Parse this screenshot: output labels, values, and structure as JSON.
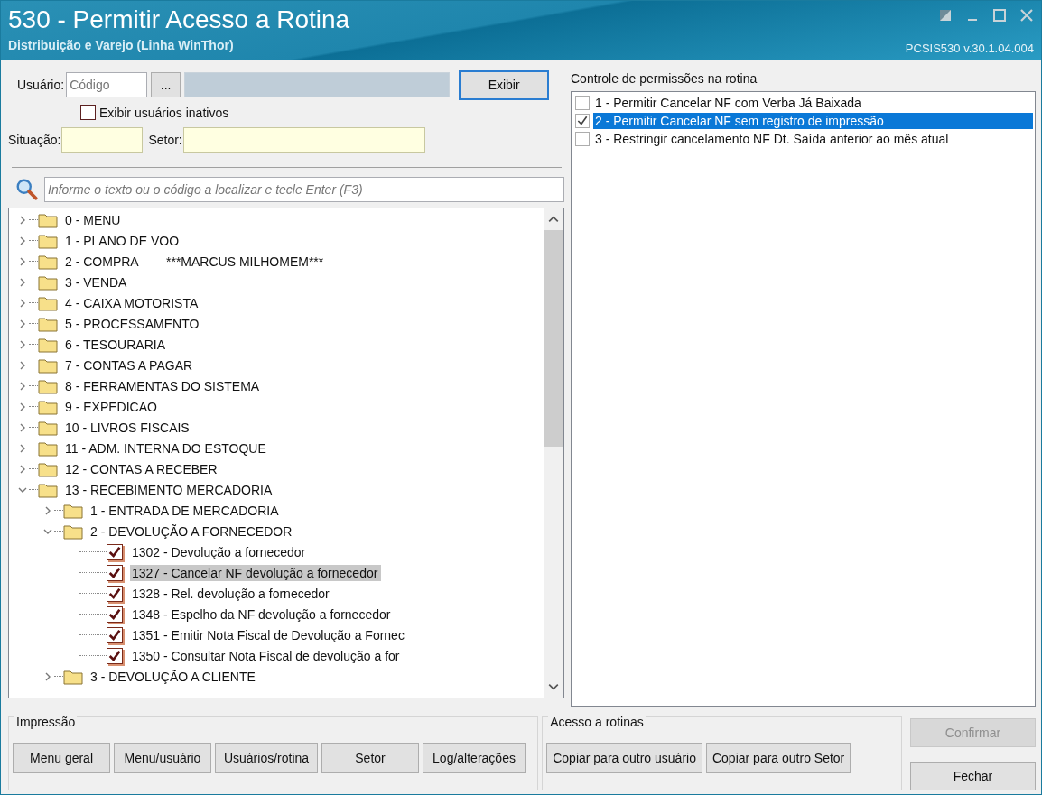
{
  "window": {
    "title": "530 - Permitir Acesso a Rotina",
    "subtitle": "Distribuição e Varejo (Linha WinThor)",
    "version": "PCSIS530  v.30.1.04.004"
  },
  "user": {
    "label": "Usuário:",
    "code_placeholder": "Código",
    "lookup_button": "...",
    "show_button": "Exibir",
    "inactive_label": "Exibir usuários inativos",
    "inactive_checked": false
  },
  "filters": [
    {
      "label": "Situação:"
    },
    {
      "label": "Setor:"
    }
  ],
  "search": {
    "placeholder": "Informe o texto ou o código a localizar e tecle Enter (F3)"
  },
  "tree": [
    {
      "kind": "folder",
      "label": "0 - MENU",
      "expanded": false,
      "selected": false
    },
    {
      "kind": "folder",
      "label": "1 - PLANO DE VOO",
      "expanded": false,
      "selected": false
    },
    {
      "kind": "folder",
      "label": "2 - COMPRA        ***MARCUS MILHOMEM***",
      "expanded": false,
      "selected": false
    },
    {
      "kind": "folder",
      "label": "3 - VENDA",
      "expanded": false,
      "selected": false
    },
    {
      "kind": "folder",
      "label": "4 - CAIXA MOTORISTA",
      "expanded": false,
      "selected": false
    },
    {
      "kind": "folder",
      "label": "5 - PROCESSAMENTO",
      "expanded": false,
      "selected": false
    },
    {
      "kind": "folder",
      "label": "6 - TESOURARIA",
      "expanded": false,
      "selected": false
    },
    {
      "kind": "folder",
      "label": "7 - CONTAS A PAGAR",
      "expanded": false,
      "selected": false
    },
    {
      "kind": "folder",
      "label": "8 - FERRAMENTAS DO SISTEMA",
      "expanded": false,
      "selected": false
    },
    {
      "kind": "folder",
      "label": "9 - EXPEDICAO",
      "expanded": false,
      "selected": false
    },
    {
      "kind": "folder",
      "label": "10 - LIVROS FISCAIS",
      "expanded": false,
      "selected": false
    },
    {
      "kind": "folder",
      "label": "11 - ADM. INTERNA DO ESTOQUE",
      "expanded": false,
      "selected": false
    },
    {
      "kind": "folder",
      "label": "12 - CONTAS A RECEBER",
      "expanded": false,
      "selected": false
    },
    {
      "kind": "folder",
      "label": "13 - RECEBIMENTO MERCADORIA",
      "expanded": true,
      "selected": false,
      "children": [
        {
          "kind": "folder",
          "label": "1 - ENTRADA DE MERCADORIA",
          "expanded": false,
          "selected": false
        },
        {
          "kind": "folder",
          "label": "2 - DEVOLUÇÃO A FORNECEDOR",
          "expanded": true,
          "selected": false,
          "children": [
            {
              "kind": "routine",
              "label": "1302 - Devolução a fornecedor",
              "checked": true,
              "selected": false
            },
            {
              "kind": "routine",
              "label": "1327 - Cancelar NF devolução a fornecedor",
              "checked": true,
              "selected": true
            },
            {
              "kind": "routine",
              "label": "1328 - Rel. devolução a fornecedor",
              "checked": true,
              "selected": false
            },
            {
              "kind": "routine",
              "label": "1348 - Espelho da NF devolução a fornecedor",
              "checked": true,
              "selected": false
            },
            {
              "kind": "routine",
              "label": "1351 - Emitir Nota Fiscal de Devolução a Fornec",
              "checked": true,
              "selected": false
            },
            {
              "kind": "routine",
              "label": "1350 - Consultar Nota Fiscal de devolução a for",
              "checked": true,
              "selected": false
            }
          ]
        },
        {
          "kind": "folder",
          "label": "3 - DEVOLUÇÃO A CLIENTE",
          "expanded": false,
          "selected": false
        }
      ]
    }
  ],
  "permissions": {
    "title": "Controle de permissões na rotina",
    "items": [
      {
        "label": "1 - Permitir Cancelar NF com Verba Já Baixada",
        "checked": false,
        "selected": false
      },
      {
        "label": "2 - Permitir Cancelar NF sem registro de impressão",
        "checked": true,
        "selected": true
      },
      {
        "label": "3 - Restringir cancelamento NF Dt. Saída anterior ao mês atual",
        "checked": false,
        "selected": false
      }
    ]
  },
  "print_group": {
    "title": "Impressão",
    "buttons": [
      "Menu geral",
      "Menu/usuário",
      "Usuários/rotina",
      "Setor",
      "Log/alterações"
    ]
  },
  "access_group": {
    "title": "Acesso a rotinas",
    "buttons": [
      "Copiar para outro usuário",
      "Copiar para outro Setor"
    ]
  },
  "actions": [
    {
      "label": "Confirmar",
      "disabled": true
    },
    {
      "label": "Fechar",
      "disabled": false
    }
  ]
}
